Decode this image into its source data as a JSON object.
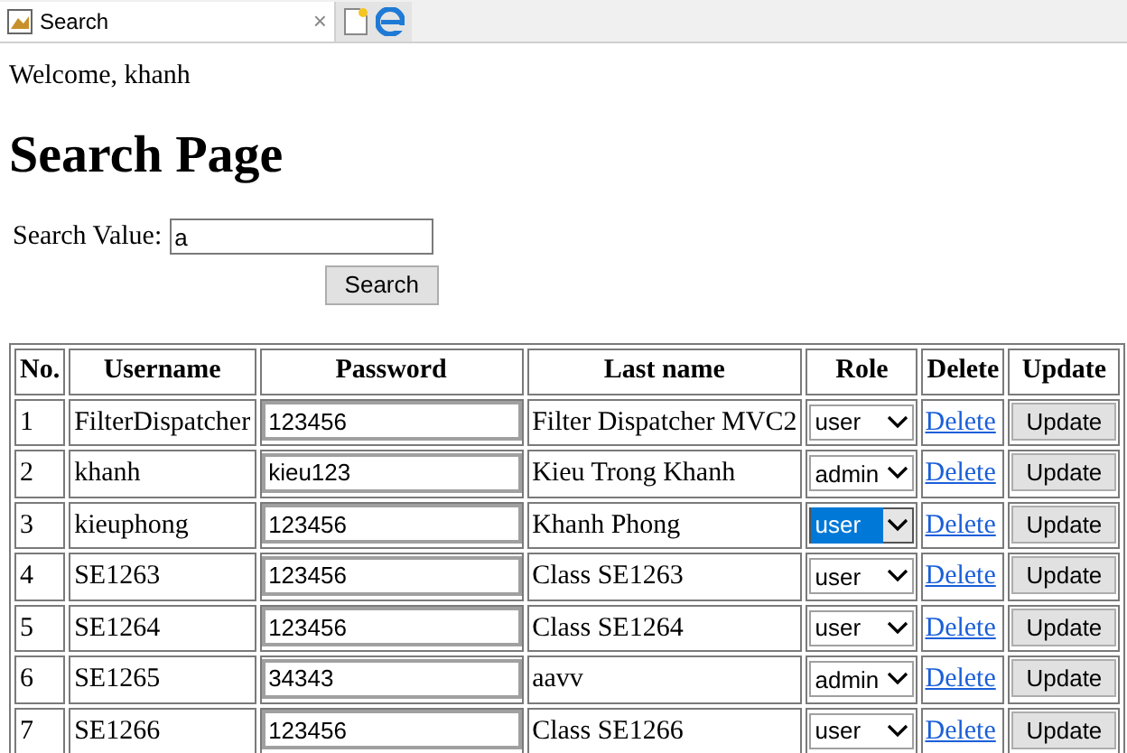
{
  "tab": {
    "title": "Search",
    "close": "×"
  },
  "welcome": "Welcome, khanh",
  "heading": "Search Page",
  "search": {
    "label": "Search Value:",
    "value": "a",
    "button": "Search"
  },
  "table": {
    "columns": [
      "No.",
      "Username",
      "Password",
      "Last name",
      "Role",
      "Delete",
      "Update"
    ],
    "rows": [
      {
        "no": "1",
        "username": "FilterDispatcher",
        "password": "123456",
        "last_name": "Filter Dispatcher MVC2",
        "role": "user",
        "focused": false,
        "delete": "Delete",
        "update": "Update"
      },
      {
        "no": "2",
        "username": "khanh",
        "password": "kieu123",
        "last_name": "Kieu Trong Khanh",
        "role": "admin",
        "focused": false,
        "delete": "Delete",
        "update": "Update"
      },
      {
        "no": "3",
        "username": "kieuphong",
        "password": "123456",
        "last_name": "Khanh Phong",
        "role": "user",
        "focused": true,
        "delete": "Delete",
        "update": "Update"
      },
      {
        "no": "4",
        "username": "SE1263",
        "password": "123456",
        "last_name": "Class SE1263",
        "role": "user",
        "focused": false,
        "delete": "Delete",
        "update": "Update"
      },
      {
        "no": "5",
        "username": "SE1264",
        "password": "123456",
        "last_name": "Class SE1264",
        "role": "user",
        "focused": false,
        "delete": "Delete",
        "update": "Update"
      },
      {
        "no": "6",
        "username": "SE1265",
        "password": "34343",
        "last_name": "aavv",
        "role": "admin",
        "focused": false,
        "delete": "Delete",
        "update": "Update"
      },
      {
        "no": "7",
        "username": "SE1266",
        "password": "123456",
        "last_name": "Class SE1266",
        "role": "user",
        "focused": false,
        "delete": "Delete",
        "update": "Update"
      }
    ]
  }
}
